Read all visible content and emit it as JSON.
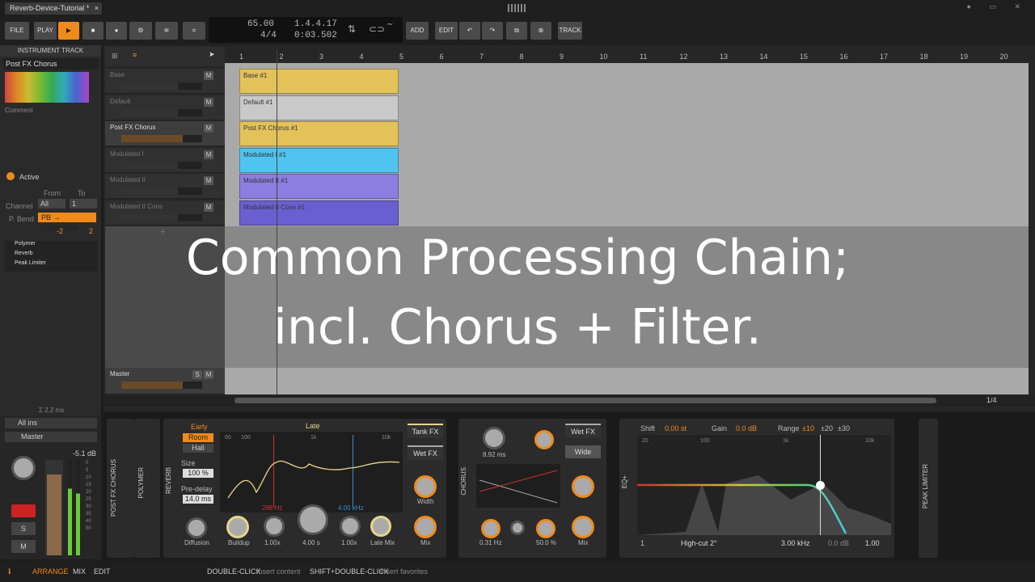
{
  "window": {
    "tab_title": "Reverb-Device-Tutorial *",
    "close": "×"
  },
  "toolbar": {
    "file": "FILE",
    "play_label": "PLAY",
    "add": "ADD",
    "edit": "EDIT",
    "track": "TRACK"
  },
  "transport": {
    "tempo": "65.00",
    "signature": "4/4",
    "position": "1.4.4.17",
    "time": "0:03.502"
  },
  "instrument_panel": {
    "header": "INSTRUMENT TRACK",
    "name": "Post FX Chorus",
    "comment_label": "Comment",
    "active_label": "Active",
    "from_label": "From",
    "to_label": "To",
    "channel_label": "Channel",
    "channel_from": "All",
    "channel_to": "1",
    "pbend_label": "P. Bend",
    "pbend_value": "PB → Expression",
    "pb_low": "-2",
    "pb_high": "2",
    "devices": [
      "Polymer",
      "Reverb",
      "Peak Limiter"
    ],
    "latency": "Σ 2.2 ms"
  },
  "io": {
    "input": "All ins",
    "output": "Master",
    "level": "-5.1 dB",
    "scale": [
      "0",
      "5",
      "10",
      "15",
      "20",
      "25",
      "30",
      "35",
      "40",
      "50"
    ]
  },
  "tracks": [
    {
      "name": "Base",
      "clip": "Base #1"
    },
    {
      "name": "Default",
      "clip": "Default #1"
    },
    {
      "name": "Post FX Chorus",
      "clip": "Post FX Chorus #1"
    },
    {
      "name": "Modulated I",
      "clip": "Modulated I #1"
    },
    {
      "name": "Modulated II",
      "clip": "Modulated II #1"
    },
    {
      "name": "Modulated II Cons",
      "clip": "Modulated II Cons #1"
    }
  ],
  "master": {
    "name": "Master"
  },
  "ruler": [
    "1",
    "2",
    "3",
    "4",
    "5",
    "6",
    "7",
    "8",
    "9",
    "10",
    "11",
    "12",
    "13",
    "14",
    "15",
    "16",
    "17",
    "18",
    "19",
    "20"
  ],
  "overlay": {
    "line1": "Common Processing Chain;",
    "line2": "incl. Chorus + Filter."
  },
  "zoom": "1/4",
  "devices": {
    "chain_label": "POST FX CHORUS",
    "polymer": "POLYMER",
    "reverb": {
      "label": "REVERB",
      "early": "Early",
      "room": "Room",
      "hall": "Hall",
      "size_label": "Size",
      "size": "100 %",
      "predelay_label": "Pre-delay",
      "predelay": "14.0 ms",
      "diffusion": "Diffusion",
      "late": "Late",
      "freq1": "298 Hz",
      "freq2": "4.00 kHz",
      "buildup": "Buildup",
      "buildup_val": "1.00x",
      "decay": "4.00 s",
      "late_val": "1.00x",
      "late_mix": "Late Mix",
      "tank_fx": "Tank FX",
      "wet_fx": "Wet FX",
      "width": "Width",
      "mix": "Mix",
      "ticks": [
        "60",
        "100",
        "1k",
        "10k"
      ]
    },
    "chorus": {
      "label": "CHORUS",
      "delay": "8.92 ms",
      "rate": "0.31 Hz",
      "depth": "50.0 %",
      "wet_fx": "Wet FX",
      "wide": "Wide",
      "mix": "Mix"
    },
    "eq": {
      "label": "EQ+",
      "shift_label": "Shift",
      "shift": "0.00 st",
      "gain_label": "Gain",
      "gain": "0.0 dB",
      "range_label": "Range",
      "r1": "±10",
      "r2": "±20",
      "r3": "±30",
      "band": "1",
      "type": "High-cut 2°",
      "freq": "3.00 kHz",
      "band_gain": "0.0 dB",
      "q": "1.00",
      "ticks": [
        "20",
        "100",
        "1k",
        "10k"
      ]
    },
    "limiter": "PEAK LIMITER"
  },
  "status": {
    "arrange": "ARRANGE",
    "mix": "MIX",
    "edit": "EDIT",
    "dbl": "DOUBLE-CLICK",
    "dbl_desc": "Insert content",
    "sdbl": "SHIFT+DOUBLE-CLICK",
    "sdbl_desc": "Insert favorites"
  }
}
